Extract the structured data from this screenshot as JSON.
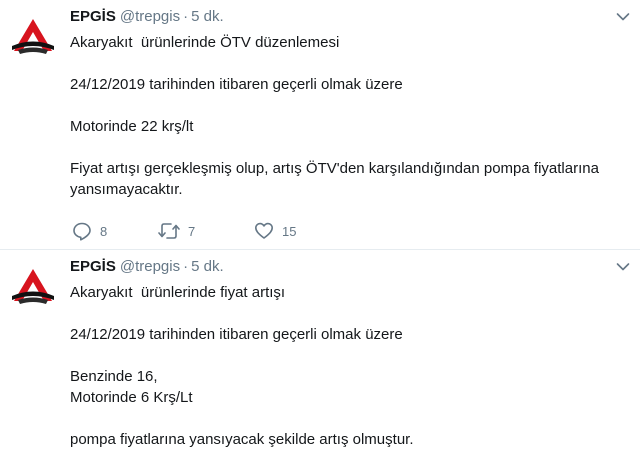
{
  "tweets": [
    {
      "author_name": "EPGİS",
      "handle": "@trepgis",
      "separator": "·",
      "time": "5 dk.",
      "lines": [
        "Akaryakıt  ürünlerinde ÖTV düzenlemesi",
        "24/12/2019 tarihinden itibaren geçerli olmak üzere",
        "Motorinde 22 krş/lt",
        "Fiyat artışı gerçekleşmiş olup, artış ÖTV'den karşılandığından pompa fiyatlarına yansımayacaktır."
      ],
      "reply_count": "8",
      "retweet_count": "7",
      "like_count": "15"
    },
    {
      "author_name": "EPGİS",
      "handle": "@trepgis",
      "separator": "·",
      "time": "5 dk.",
      "lines": [
        "Akaryakıt  ürünlerinde fiyat artışı",
        "24/12/2019 tarihinden itibaren geçerli olmak üzere",
        "Benzinde 16,",
        "Motorinde 6 Krş/Lt",
        "pompa fiyatlarına yansıyacak şekilde artış olmuştur."
      ]
    }
  ],
  "icons": {
    "avatar": "epgis-logo-icon",
    "menu": "chevron-down-icon",
    "reply": "reply-icon",
    "retweet": "retweet-icon",
    "like": "heart-icon"
  },
  "colors": {
    "text": "#14171a",
    "secondary": "#657786",
    "logo_red": "#d7141e",
    "divider": "#e6ecf0"
  }
}
